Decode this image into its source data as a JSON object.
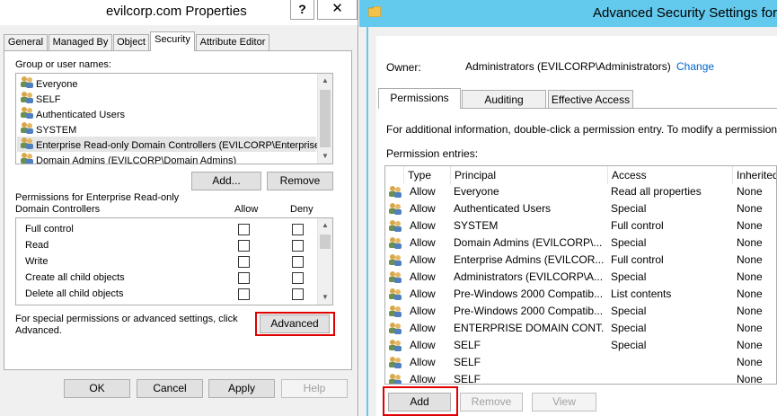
{
  "left_dialog": {
    "title": "evilcorp.com Properties",
    "help_glyph": "?",
    "close_glyph": "✕",
    "tabs": [
      "General",
      "Managed By",
      "Object",
      "Security",
      "Attribute Editor"
    ],
    "group_label": "Group or user names:",
    "users": [
      "Everyone",
      "SELF",
      "Authenticated Users",
      "SYSTEM",
      "Enterprise Read-only Domain Controllers (EVILCORP\\Enterprise...",
      "Domain Admins (EVILCORP\\Domain Admins)"
    ],
    "add_button": "Add...",
    "remove_button": "Remove",
    "perm_label_line1": "Permissions for Enterprise Read-only",
    "perm_label_line2": "Domain Controllers",
    "allow_header": "Allow",
    "deny_header": "Deny",
    "permissions": [
      "Full control",
      "Read",
      "Write",
      "Create all child objects",
      "Delete all child objects"
    ],
    "special_line1": "For special permissions or advanced settings, click",
    "special_line2": "Advanced.",
    "advanced_button": "Advanced",
    "ok_button": "OK",
    "cancel_button": "Cancel",
    "apply_button": "Apply",
    "help_button": "Help"
  },
  "right_dialog": {
    "title": "Advanced Security Settings for",
    "owner_label": "Owner:",
    "owner_value": "Administrators (EVILCORP\\Administrators)",
    "owner_change": "Change",
    "tabs": [
      "Permissions",
      "Auditing",
      "Effective Access"
    ],
    "info_text": "For additional information, double-click a permission entry. To modify a permission",
    "entries_label": "Permission entries:",
    "columns": [
      "Type",
      "Principal",
      "Access",
      "Inherited"
    ],
    "entries": [
      {
        "type": "Allow",
        "principal": "Everyone",
        "access": "Read all properties",
        "inherited": "None"
      },
      {
        "type": "Allow",
        "principal": "Authenticated Users",
        "access": "Special",
        "inherited": "None"
      },
      {
        "type": "Allow",
        "principal": "SYSTEM",
        "access": "Full control",
        "inherited": "None"
      },
      {
        "type": "Allow",
        "principal": "Domain Admins (EVILCORP\\...",
        "access": "Special",
        "inherited": "None"
      },
      {
        "type": "Allow",
        "principal": "Enterprise Admins (EVILCOR...",
        "access": "Full control",
        "inherited": "None"
      },
      {
        "type": "Allow",
        "principal": "Administrators (EVILCORP\\A...",
        "access": "Special",
        "inherited": "None"
      },
      {
        "type": "Allow",
        "principal": "Pre-Windows 2000 Compatib...",
        "access": "List contents",
        "inherited": "None"
      },
      {
        "type": "Allow",
        "principal": "Pre-Windows 2000 Compatib...",
        "access": "Special",
        "inherited": "None"
      },
      {
        "type": "Allow",
        "principal": "ENTERPRISE DOMAIN CONT...",
        "access": "Special",
        "inherited": "None"
      },
      {
        "type": "Allow",
        "principal": "SELF",
        "access": "Special",
        "inherited": "None"
      },
      {
        "type": "Allow",
        "principal": "SELF",
        "access": "",
        "inherited": "None"
      },
      {
        "type": "Allow",
        "principal": "SELF",
        "access": "",
        "inherited": "None"
      }
    ],
    "add_button": "Add",
    "remove_button": "Remove",
    "view_button": "View"
  },
  "colors": {
    "title_accent": "#63c9ed",
    "highlight_box": "#e00000",
    "link": "#0066cc"
  }
}
